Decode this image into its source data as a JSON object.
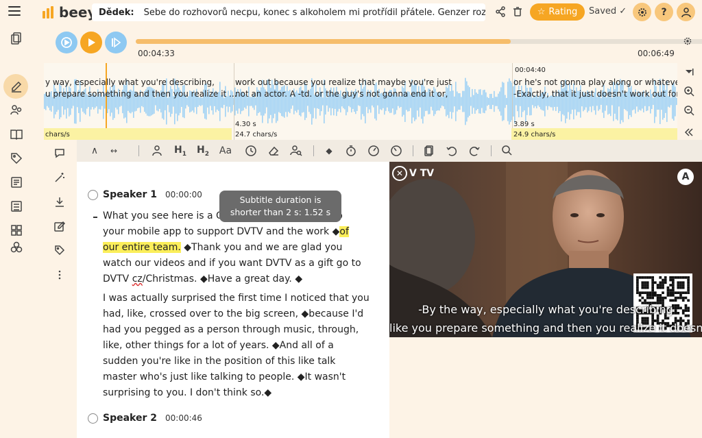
{
  "header": {
    "logo_text": "beey",
    "title_label": "Dědek:",
    "title_text": "Sebe do rozhovorů necpu, konec s alkoholem mi protřídil přátele. Genzer roze",
    "rating_label": "Rating",
    "saved_label": "Saved ✓",
    "help_label": "?"
  },
  "player": {
    "current_time": "00:04:33",
    "total_time": "00:06:49",
    "progress": 0.64
  },
  "waveform": {
    "segments": [
      {
        "line1": "y way, especially what you're describing,",
        "line2": "u prepare something and then you realize it ...",
        "duration": "",
        "rate": "chars/s"
      },
      {
        "line1": "work out because you realize that maybe you're just",
        "line2": "not an actor. A  -td. or the guy's not gonna end it or,",
        "duration": "4.30 s",
        "rate": "24.7 chars/s"
      },
      {
        "timestamp": "00:04:40",
        "line1": "or he's not gonna play along or whatever.",
        "line2": "-Exactly, that it just doesn't work out for s",
        "duration": "3.89 s",
        "rate": "24.9 chars/s"
      }
    ]
  },
  "editor": {
    "speaker1": {
      "name": "Speaker 1",
      "time": "00:00:00"
    },
    "speaker2": {
      "name": "Speaker 2",
      "time": "00:00:46"
    },
    "tooltip_line1": "Subtitle duration is",
    "tooltip_line2": "shorter than 2 s: 1.52 s",
    "p1_l1a": "What you see here is a QR",
    "p1_l1b": "to",
    "p1_l2a": "your mobile app to support DVTV and the work ◆",
    "p1_l2hl": "of",
    "p1_l3hl": "our entire team.",
    "p1_l3b": " ◆Thank you and we are glad you",
    "p1_l4": "watch our videos and if you want DVTV as a gift go to",
    "p1_l5a": "DVTV ",
    "p1_l5u": "cz",
    "p1_l5b": "/Christmas. ◆Have a great day. ◆",
    "p2_lines": [
      "I was actually surprised the first time I noticed that you",
      "had, like, crossed over to the big screen, ◆because I'd",
      "had you pegged as a person through music, through,",
      "like, other things for a lot of years. ◆And all of a",
      "sudden you're like in the position of this like talk",
      "master who's just like talking to people. ◆It wasn't",
      "surprising to you. I don't think so.◆"
    ]
  },
  "video": {
    "logo_text": "V TV",
    "badge": "A",
    "subtitle_line1": "-By the way, especially what you're describing",
    "subtitle_line2": "like you prepare something and then you realize it doesn't"
  },
  "colors": {
    "accent": "#f6a623",
    "player_blue": "#8ec9f2",
    "highlight": "#fbee5a",
    "wave": "#9fd2f5"
  }
}
